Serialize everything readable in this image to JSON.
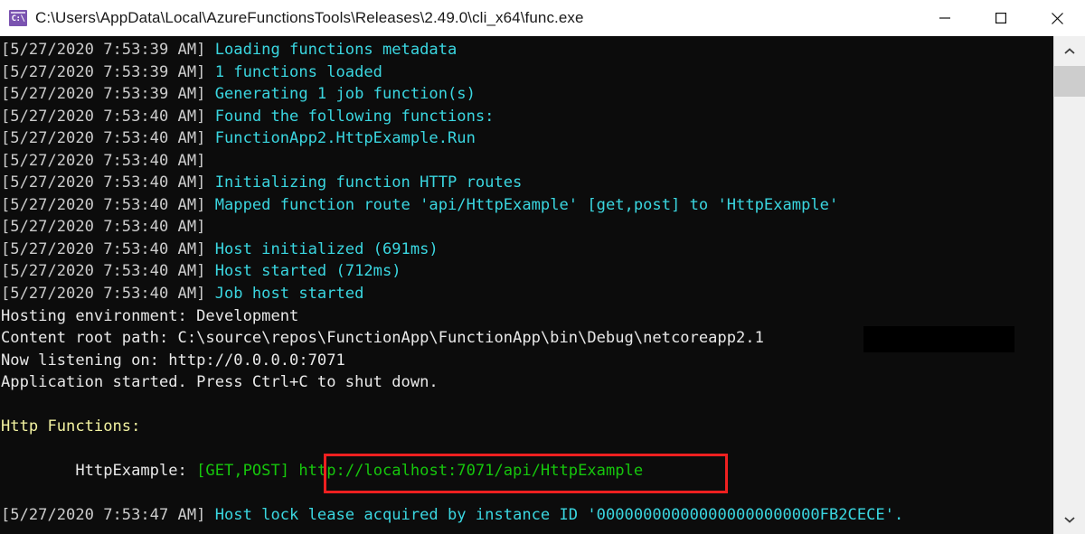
{
  "window": {
    "title": "C:\\Users\\AppData\\Local\\AzureFunctionsTools\\Releases\\2.49.0\\cli_x64\\func.exe",
    "icon": "console-cmd-icon",
    "icon_text": "C:\\",
    "controls": {
      "minimize": "minimize-button",
      "maximize": "maximize-button",
      "close": "close-button"
    }
  },
  "colors": {
    "background": "#0c0c0c",
    "timestamp": "#cccccc",
    "info": "#3ad6e0",
    "white": "#e8e8e8",
    "yellow": "#f2f2a0",
    "green": "#16c60c",
    "highlight_box": "#ee2020",
    "titlebar_bg": "#ffffff",
    "scrollbar_track": "#f0f0f0",
    "scrollbar_thumb": "#cdcdcd"
  },
  "console": {
    "lines": [
      {
        "ts": "[5/27/2020 7:53:39 AM]",
        "msg": " Loading functions metadata",
        "cls": "cy"
      },
      {
        "ts": "[5/27/2020 7:53:39 AM]",
        "msg": " 1 functions loaded",
        "cls": "cy"
      },
      {
        "ts": "[5/27/2020 7:53:39 AM]",
        "msg": " Generating 1 job function(s)",
        "cls": "cy"
      },
      {
        "ts": "[5/27/2020 7:53:40 AM]",
        "msg": " Found the following functions:",
        "cls": "cy"
      },
      {
        "ts": "[5/27/2020 7:53:40 AM]",
        "msg": " FunctionApp2.HttpExample.Run",
        "cls": "cy"
      },
      {
        "ts": "[5/27/2020 7:53:40 AM]",
        "msg": "",
        "cls": "cy"
      },
      {
        "ts": "[5/27/2020 7:53:40 AM]",
        "msg": " Initializing function HTTP routes",
        "cls": "cy"
      },
      {
        "ts": "[5/27/2020 7:53:40 AM]",
        "msg": " Mapped function route 'api/HttpExample' [get,post] to 'HttpExample'",
        "cls": "cy"
      },
      {
        "ts": "[5/27/2020 7:53:40 AM]",
        "msg": "",
        "cls": "cy"
      },
      {
        "ts": "[5/27/2020 7:53:40 AM]",
        "msg": " Host initialized (691ms)",
        "cls": "cy"
      },
      {
        "ts": "[5/27/2020 7:53:40 AM]",
        "msg": " Host started (712ms)",
        "cls": "cy"
      },
      {
        "ts": "[5/27/2020 7:53:40 AM]",
        "msg": " Job host started",
        "cls": "cy"
      },
      {
        "ts": "",
        "msg": "Hosting environment: Development",
        "cls": "wh"
      },
      {
        "ts": "",
        "msg": "Content root path: C:\\source\\repos\\FunctionApp\\FunctionApp\\bin\\Debug\\netcoreapp2.1",
        "cls": "wh"
      },
      {
        "ts": "",
        "msg": "Now listening on: http://0.0.0.0:7071",
        "cls": "wh"
      },
      {
        "ts": "",
        "msg": "Application started. Press Ctrl+C to shut down.",
        "cls": "wh"
      },
      {
        "ts": "",
        "msg": "",
        "cls": "wh"
      },
      {
        "ts": "",
        "msg": "Http Functions:",
        "cls": "ye"
      },
      {
        "ts": "",
        "msg": "",
        "cls": "wh"
      }
    ],
    "function_entry": {
      "indent": "        ",
      "name": "HttpExample:",
      "methods": "[GET,POST]",
      "url": "http://localhost:7071/api/HttpExample"
    },
    "trailing_lines": [
      {
        "ts": "",
        "msg": "",
        "cls": "wh"
      },
      {
        "ts": "[5/27/2020 7:53:47 AM]",
        "msg": " Host lock lease acquired by instance ID '000000000000000000000000FB2CECE'.",
        "cls": "cy"
      }
    ]
  },
  "scrollbar": {
    "up_arrow": "scroll-up-arrow",
    "down_arrow": "scroll-down-arrow",
    "thumb": "scrollbar-thumb"
  }
}
